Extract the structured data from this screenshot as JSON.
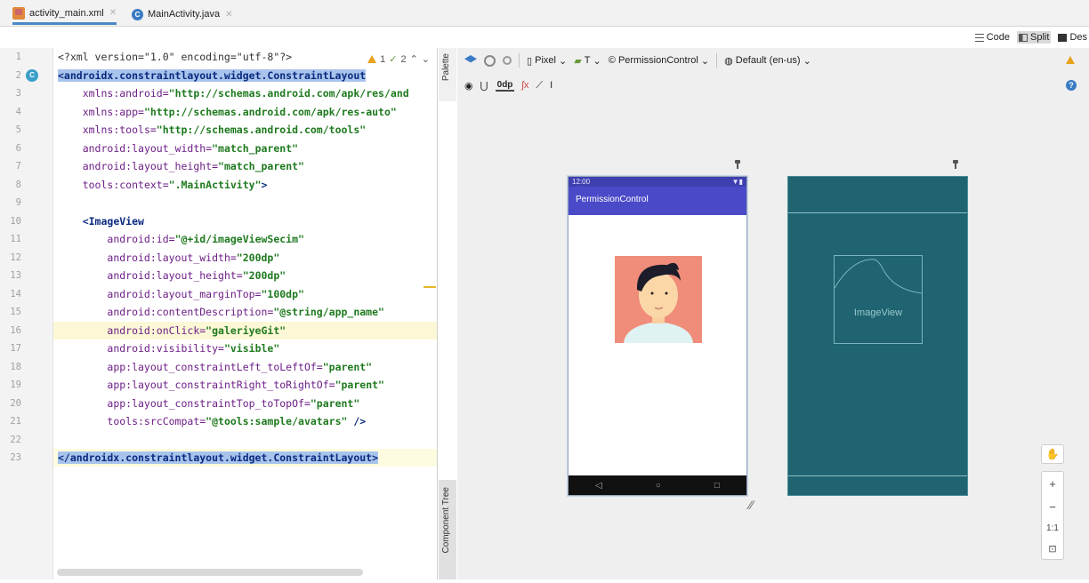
{
  "tabs": [
    {
      "label": "activity_main.xml",
      "active": true,
      "icon": "xml-file-icon"
    },
    {
      "label": "MainActivity.java",
      "active": false,
      "icon": "java-class-icon"
    }
  ],
  "view_modes": [
    {
      "label": "Code",
      "active": false
    },
    {
      "label": "Split",
      "active": true
    },
    {
      "label": "Des",
      "active": false
    }
  ],
  "editor": {
    "warnings": "1",
    "weak_warnings": "2",
    "lines": [
      {
        "n": "1",
        "segments": [
          [
            "pi",
            "<?xml version=\"1.0\" encoding=\"utf-8\"?>"
          ]
        ]
      },
      {
        "n": "2",
        "selected": true,
        "segments": [
          [
            "tag",
            "<androidx.constraintlayout.widget.ConstraintLayout"
          ]
        ]
      },
      {
        "n": "3",
        "segments": [
          [
            "pad",
            "    "
          ],
          [
            "attr",
            "xmlns:android="
          ],
          [
            "val",
            "\"http://schemas.android.com/apk/res/and"
          ]
        ]
      },
      {
        "n": "4",
        "segments": [
          [
            "pad",
            "    "
          ],
          [
            "attr",
            "xmlns:app="
          ],
          [
            "val",
            "\"http://schemas.android.com/apk/res-auto\""
          ]
        ]
      },
      {
        "n": "5",
        "segments": [
          [
            "pad",
            "    "
          ],
          [
            "attr",
            "xmlns:tools="
          ],
          [
            "val",
            "\"http://schemas.android.com/tools\""
          ]
        ]
      },
      {
        "n": "6",
        "segments": [
          [
            "pad",
            "    "
          ],
          [
            "attr",
            "android:layout_width="
          ],
          [
            "val",
            "\"match_parent\""
          ]
        ]
      },
      {
        "n": "7",
        "segments": [
          [
            "pad",
            "    "
          ],
          [
            "attr",
            "android:layout_height="
          ],
          [
            "val",
            "\"match_parent\""
          ]
        ]
      },
      {
        "n": "8",
        "segments": [
          [
            "pad",
            "    "
          ],
          [
            "attr",
            "tools:context="
          ],
          [
            "val",
            "\".MainActivity\""
          ],
          [
            "tag",
            ">"
          ]
        ]
      },
      {
        "n": "9",
        "segments": []
      },
      {
        "n": "10",
        "segments": [
          [
            "pad",
            "    "
          ],
          [
            "tag",
            "<ImageView"
          ]
        ]
      },
      {
        "n": "11",
        "segments": [
          [
            "pad",
            "        "
          ],
          [
            "attr",
            "android:id="
          ],
          [
            "val",
            "\"@+id/imageViewSecim\""
          ]
        ]
      },
      {
        "n": "12",
        "segments": [
          [
            "pad",
            "        "
          ],
          [
            "attr",
            "android:layout_width="
          ],
          [
            "val",
            "\"200dp\""
          ]
        ]
      },
      {
        "n": "13",
        "segments": [
          [
            "pad",
            "        "
          ],
          [
            "attr",
            "android:layout_height="
          ],
          [
            "val",
            "\"200dp\""
          ]
        ]
      },
      {
        "n": "14",
        "segments": [
          [
            "pad",
            "        "
          ],
          [
            "attr",
            "android:layout_marginTop="
          ],
          [
            "val",
            "\"100dp\""
          ]
        ]
      },
      {
        "n": "15",
        "segments": [
          [
            "pad",
            "        "
          ],
          [
            "attr",
            "android:contentDescription="
          ],
          [
            "val",
            "\"@string/app_name\""
          ]
        ]
      },
      {
        "n": "16",
        "highlight": true,
        "segments": [
          [
            "pad",
            "        "
          ],
          [
            "attr",
            "android:onClick="
          ],
          [
            "val",
            "\"galeriyeGit\""
          ]
        ]
      },
      {
        "n": "17",
        "segments": [
          [
            "pad",
            "        "
          ],
          [
            "attr",
            "android:visibility="
          ],
          [
            "val",
            "\"visible\""
          ]
        ]
      },
      {
        "n": "18",
        "segments": [
          [
            "pad",
            "        "
          ],
          [
            "attr",
            "app:layout_constraintLeft_toLeftOf="
          ],
          [
            "val",
            "\"parent\""
          ]
        ]
      },
      {
        "n": "19",
        "segments": [
          [
            "pad",
            "        "
          ],
          [
            "attr",
            "app:layout_constraintRight_toRightOf="
          ],
          [
            "val",
            "\"parent\""
          ]
        ]
      },
      {
        "n": "20",
        "segments": [
          [
            "pad",
            "        "
          ],
          [
            "attr",
            "app:layout_constraintTop_toTopOf="
          ],
          [
            "val",
            "\"parent\""
          ]
        ]
      },
      {
        "n": "21",
        "segments": [
          [
            "pad",
            "        "
          ],
          [
            "attr",
            "tools:srcCompat="
          ],
          [
            "val",
            "\"@tools:sample/avatars\""
          ],
          [
            "tag",
            " />"
          ]
        ]
      },
      {
        "n": "22",
        "segments": []
      },
      {
        "n": "23",
        "selected": true,
        "current": true,
        "segments": [
          [
            "tag",
            "</androidx.constraintlayout.widget.ConstraintLayout>"
          ]
        ]
      }
    ]
  },
  "side_panels": {
    "palette": "Palette",
    "component_tree": "Component Tree"
  },
  "design_toolbar": {
    "device": "Pixel",
    "theme_letter": "T",
    "theme": "PermissionControl",
    "locale": "Default (en-us)",
    "margin": "0dp"
  },
  "preview": {
    "status_time": "12:00",
    "app_title": "PermissionControl",
    "blueprint_label": "ImageView"
  },
  "zoom_controls": {
    "zoom_in": "+",
    "zoom_out": "−",
    "actual_size": "1:1"
  },
  "colors": {
    "app_bar": "#4a4ac8",
    "status_bar": "#3f3fb0",
    "avatar_bg": "#f08c7a",
    "blueprint_bg": "#1f6470",
    "selection": "#a9c4ec"
  }
}
